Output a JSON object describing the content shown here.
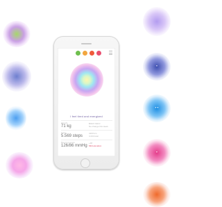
{
  "screen": {
    "mood_caption": "I feel tired and energized",
    "mood_dots": [
      {
        "color": "#6fbf4f"
      },
      {
        "color": "#f2a640"
      },
      {
        "color": "#ef5a3a"
      },
      {
        "color": "#e94f6f"
      }
    ],
    "stats": [
      {
        "label": "Weight",
        "value": "71 kg",
        "side_1": "BODY INFO",
        "side_2": "No change this week"
      },
      {
        "label": "Steps",
        "value": "5.569 steps",
        "side_1": "4163 km",
        "side_2": "4 234 kcal"
      },
      {
        "label": "Blood pressure",
        "value": "126/86 mmHg",
        "side_1": "+18",
        "side_2": "Mild elevation"
      }
    ]
  },
  "colors": {
    "accent": "#e0506b",
    "caption": "#7a6aa8"
  }
}
